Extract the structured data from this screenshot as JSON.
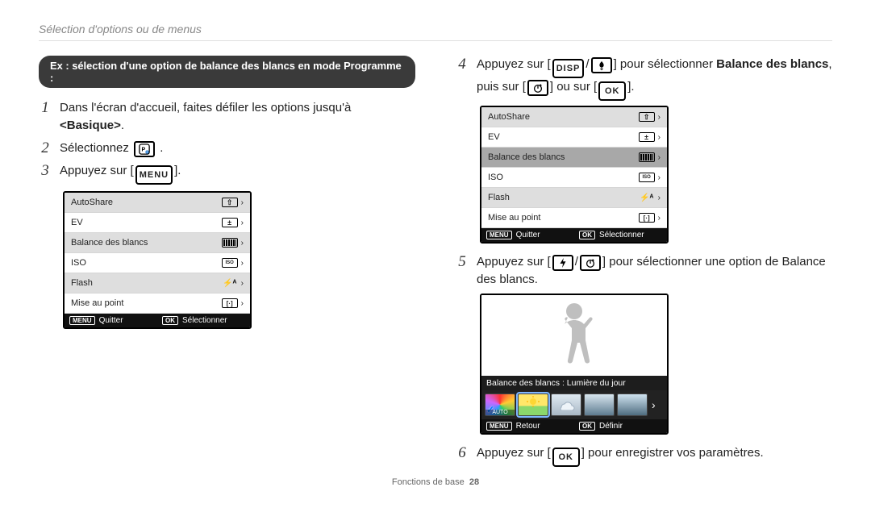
{
  "breadcrumb": "Sélection d'options ou de menus",
  "note": "Ex : sélection d'une option de balance des blancs en mode Programme :",
  "left_steps": {
    "step1": {
      "pre": "Dans l'écran d'accueil, faites défiler les options jusqu'à ",
      "target": "<Basique>",
      "post": "."
    },
    "step2": {
      "pre": "Sélectionnez ",
      "icon_name": "mode-P-icon",
      "post": "."
    },
    "step3": {
      "pre": "Appuyez sur [",
      "button": "MENU",
      "post": "]."
    }
  },
  "right_steps": {
    "step4": {
      "pre": "Appuyez sur [",
      "btn_a": "DISP",
      "btn_b_icon": "macro-icon",
      "mid": "] pour sélectionner ",
      "target": "Balance des blancs",
      "mid2": ", puis sur [",
      "btn_c_icon": "timer-icon",
      "mid3": "] ou sur [",
      "btn_d": "OK",
      "post": "]."
    },
    "step5": {
      "pre": "Appuyez sur [",
      "btn_a_icon": "flash-icon",
      "btn_b_icon": "timer-icon",
      "post": "] pour sélectionner une option de Balance des blancs."
    },
    "step6": {
      "pre": "Appuyez sur [",
      "btn": "OK",
      "post": "] pour enregistrer vos paramètres."
    }
  },
  "menu": {
    "items": [
      {
        "label": "AutoShare",
        "icon": "share"
      },
      {
        "label": "EV",
        "icon": "plusminus"
      },
      {
        "label": "Balance des blancs",
        "icon": "bars"
      },
      {
        "label": "ISO",
        "icon": "iso"
      },
      {
        "label": "Flash",
        "icon": "flash"
      },
      {
        "label": "Mise au point",
        "icon": "af"
      }
    ],
    "footer_left": "Quitter",
    "footer_left_btn": "MENU",
    "footer_right": "Sélectionner",
    "footer_right_btn": "OK"
  },
  "wb_preview": {
    "label": "Balance des blancs : Lumière du jour",
    "footer_left": "Retour",
    "footer_left_btn": "MENU",
    "footer_right": "Définir",
    "footer_right_btn": "OK"
  },
  "page_footer": {
    "section": "Fonctions de base",
    "page": "28"
  }
}
